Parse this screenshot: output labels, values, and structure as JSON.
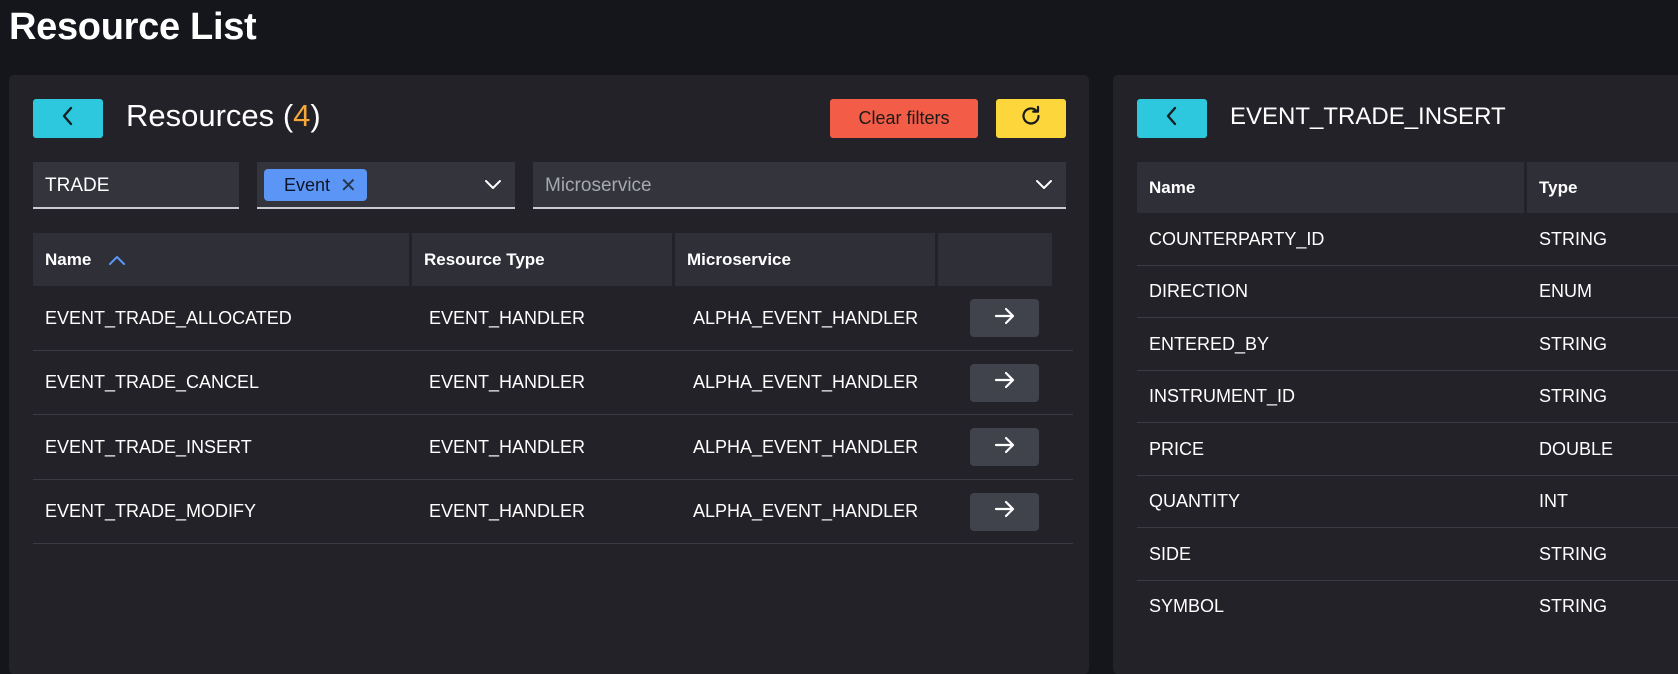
{
  "page": {
    "title": "Resource List"
  },
  "list_panel": {
    "title": "Resources",
    "count_open": "(",
    "count": "4",
    "count_close": ")",
    "clear_filters_label": "Clear filters",
    "filters": {
      "search_value": "TRADE",
      "type_chip": "Event",
      "microservice_placeholder": "Microservice"
    },
    "columns": [
      "Name",
      "Resource Type",
      "Microservice"
    ],
    "rows": [
      {
        "name": "EVENT_TRADE_ALLOCATED",
        "type": "EVENT_HANDLER",
        "microservice": "ALPHA_EVENT_HANDLER"
      },
      {
        "name": "EVENT_TRADE_CANCEL",
        "type": "EVENT_HANDLER",
        "microservice": "ALPHA_EVENT_HANDLER"
      },
      {
        "name": "EVENT_TRADE_INSERT",
        "type": "EVENT_HANDLER",
        "microservice": "ALPHA_EVENT_HANDLER"
      },
      {
        "name": "EVENT_TRADE_MODIFY",
        "type": "EVENT_HANDLER",
        "microservice": "ALPHA_EVENT_HANDLER"
      }
    ]
  },
  "detail_panel": {
    "title": "EVENT_TRADE_INSERT",
    "columns": [
      "Name",
      "Type"
    ],
    "rows": [
      {
        "name": "COUNTERPARTY_ID",
        "type": "STRING"
      },
      {
        "name": "DIRECTION",
        "type": "ENUM"
      },
      {
        "name": "ENTERED_BY",
        "type": "STRING"
      },
      {
        "name": "INSTRUMENT_ID",
        "type": "STRING"
      },
      {
        "name": "PRICE",
        "type": "DOUBLE"
      },
      {
        "name": "QUANTITY",
        "type": "INT"
      },
      {
        "name": "SIDE",
        "type": "STRING"
      },
      {
        "name": "SYMBOL",
        "type": "STRING"
      }
    ]
  },
  "icons": {
    "back": "chevron-left-icon",
    "refresh": "refresh-icon",
    "open_row": "arrow-right-icon",
    "dropdown": "chevron-down-icon",
    "chip_remove": "close-icon",
    "sort": "sort-ascending-icon"
  },
  "colors": {
    "accent_cyan": "#2ec8de",
    "clear_red": "#f35c46",
    "refresh_yellow": "#fdd63b",
    "chip_blue": "#5b96f6",
    "count_orange": "#f6a83a"
  }
}
